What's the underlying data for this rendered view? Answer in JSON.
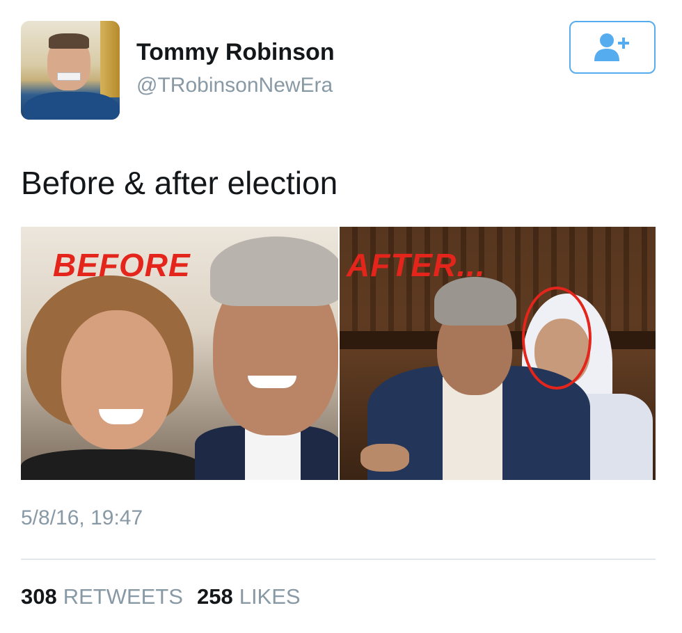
{
  "user": {
    "name": "Tommy Robinson",
    "handle": "@TRobinsonNewEra"
  },
  "follow_button": {
    "icon": "add-user-icon"
  },
  "tweet": {
    "text": "Before & after election",
    "media": {
      "left_overlay": "BEFORE",
      "right_overlay": "AFTER..."
    },
    "timestamp": "5/8/16, 19:47"
  },
  "stats": {
    "retweets_count": "308",
    "retweets_label": "RETWEETS",
    "likes_count": "258",
    "likes_label": "LIKES"
  },
  "colors": {
    "accent": "#55acee",
    "text_primary": "#14171a",
    "text_secondary": "#8899a6",
    "overlay_red": "#e3251c",
    "divider": "#e1e8ed"
  }
}
